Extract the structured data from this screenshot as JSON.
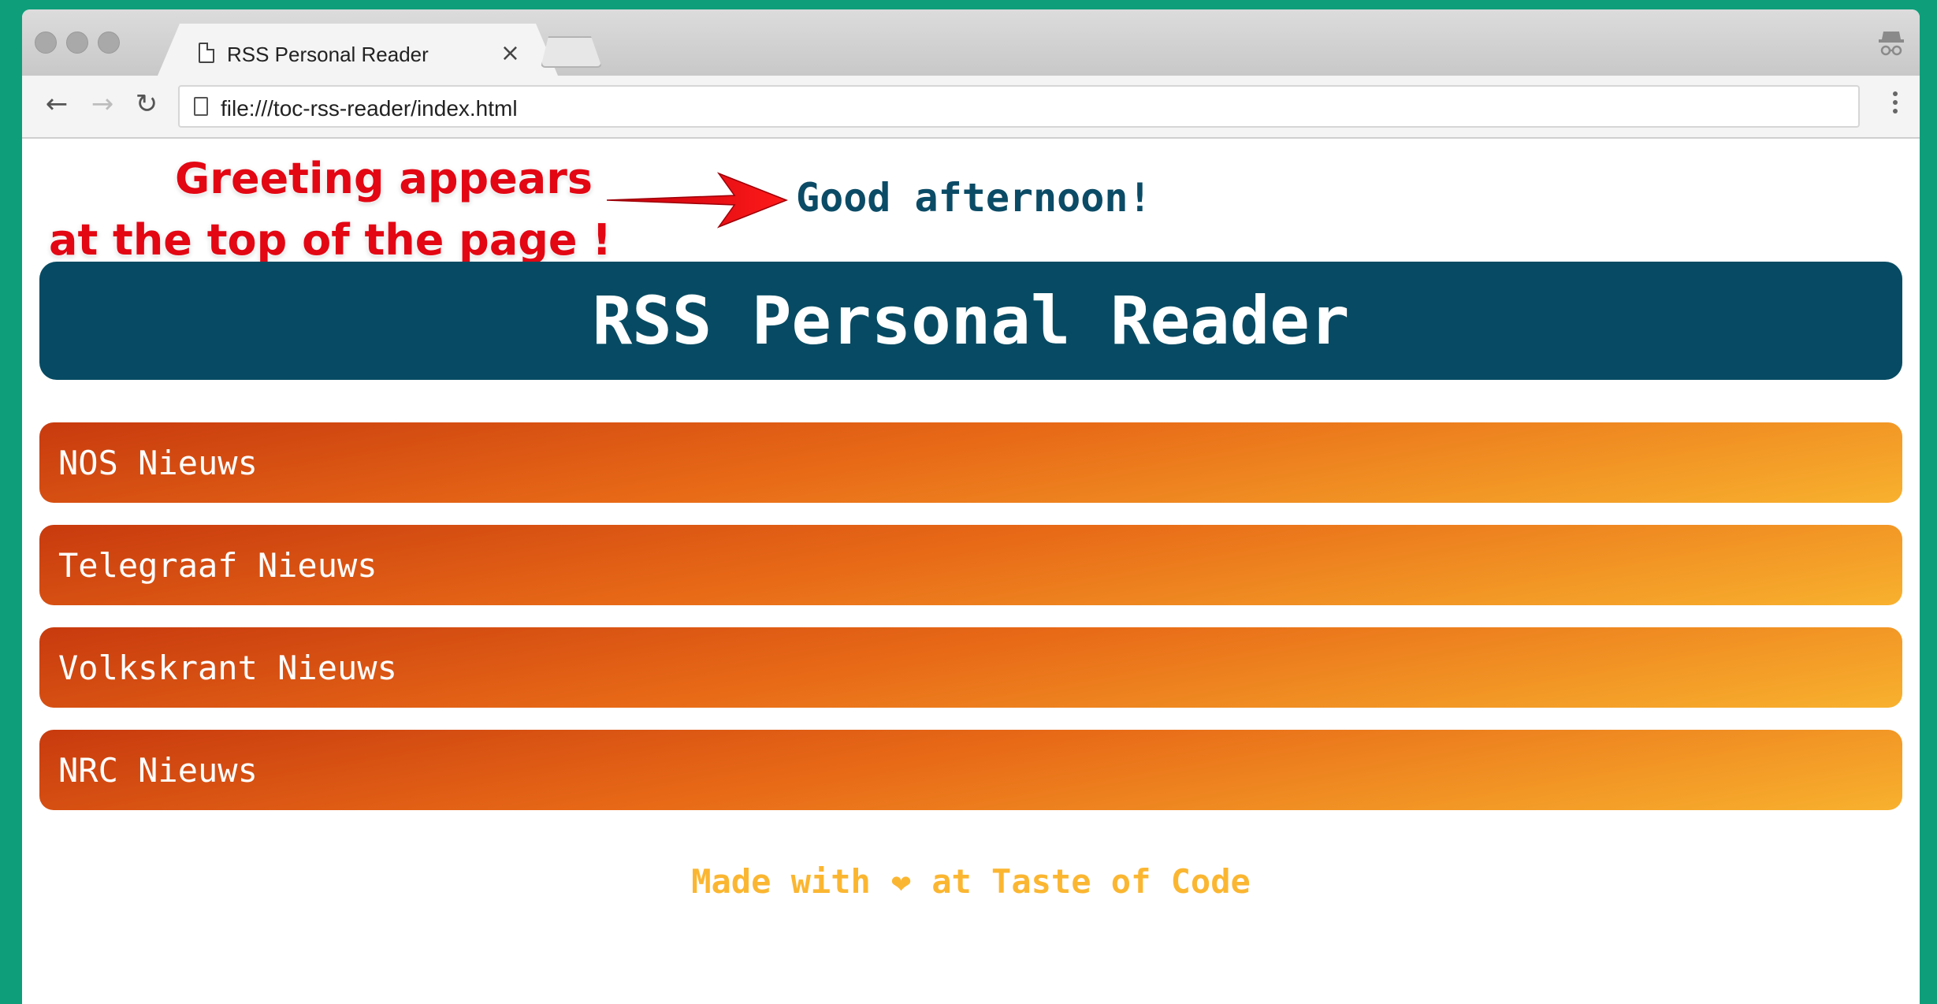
{
  "browser": {
    "tab": {
      "title": "RSS Personal Reader",
      "close_glyph": "×"
    },
    "address": {
      "url": "file:///toc-rss-reader/index.html"
    },
    "nav": {
      "back_glyph": "←",
      "forward_glyph": "→",
      "reload_glyph": "↻"
    }
  },
  "annotation": {
    "line1": "Greeting appears",
    "line2": "at the top of the page !",
    "color": "#e30613"
  },
  "page": {
    "greeting": "Good afternoon!",
    "title": "RSS Personal Reader",
    "feeds": [
      {
        "label": "NOS Nieuws"
      },
      {
        "label": "Telegraaf Nieuws"
      },
      {
        "label": "Volkskrant Nieuws"
      },
      {
        "label": "NRC Nieuws"
      }
    ],
    "footer": {
      "prefix": "Made with",
      "heart_glyph": "❤",
      "suffix": "at Taste of Code"
    }
  },
  "colors": {
    "background": "#0e9e7a",
    "header": "#064b63",
    "feed_gradient_start": "#c83a0e",
    "feed_gradient_end": "#f8b12e",
    "footer_text": "#fbb631",
    "greeting_text": "#0b4b66"
  },
  "icons": [
    "page-icon",
    "close-icon",
    "back-arrow-icon",
    "forward-arrow-icon",
    "reload-icon",
    "incognito-icon",
    "menu-dots-icon",
    "arrow-annotation-icon",
    "heart-icon"
  ]
}
